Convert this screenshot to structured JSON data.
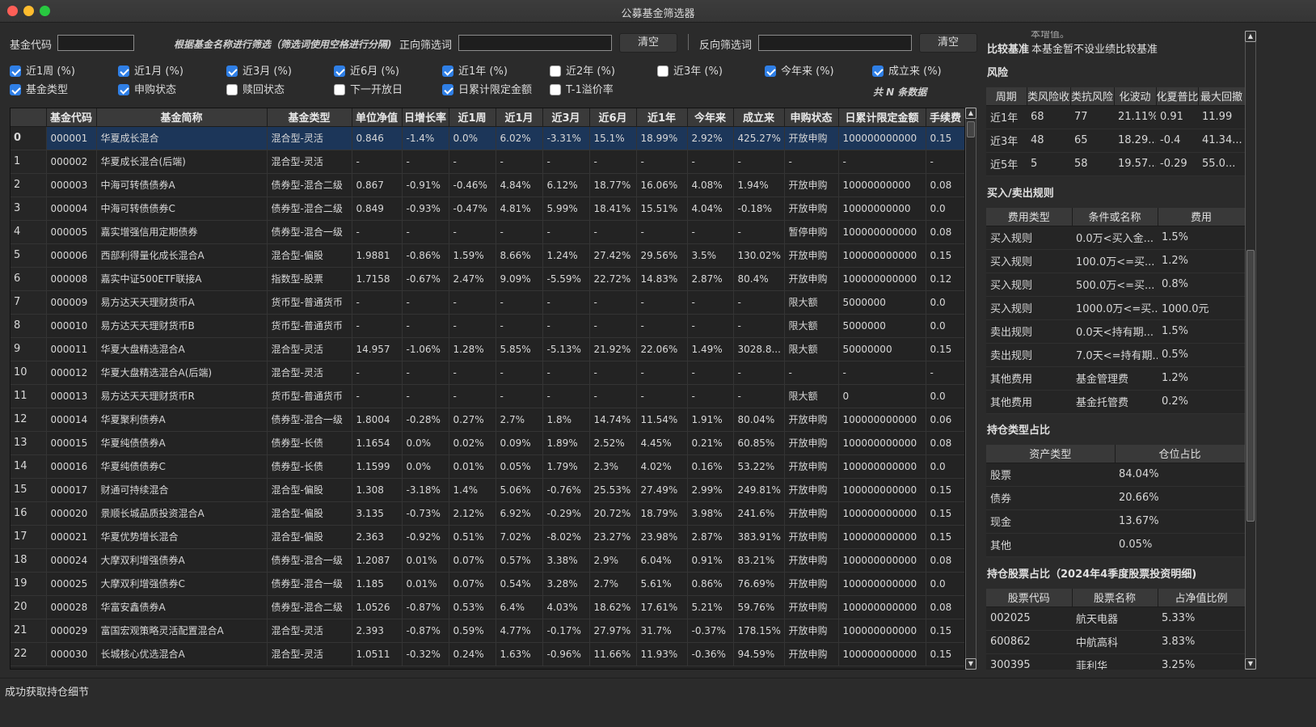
{
  "window": {
    "title": "公募基金筛选器"
  },
  "filter": {
    "code_label": "基金代码",
    "hint": "根据基金名称进行筛选（筛选词使用空格进行分隔)",
    "pos_label": "正向筛选词",
    "neg_label": "反向筛选词",
    "clear1": "清空",
    "clear2": "清空"
  },
  "checks": [
    {
      "label": "近1周 (%)",
      "checked": true
    },
    {
      "label": "近1月 (%)",
      "checked": true
    },
    {
      "label": "近3月 (%)",
      "checked": true
    },
    {
      "label": "近6月 (%)",
      "checked": true
    },
    {
      "label": "近1年 (%)",
      "checked": true
    },
    {
      "label": "近2年 (%)",
      "checked": false
    },
    {
      "label": "近3年 (%)",
      "checked": false
    },
    {
      "label": "今年来 (%)",
      "checked": true
    },
    {
      "label": "成立来 (%)",
      "checked": true
    },
    {
      "label": "基金类型",
      "checked": true
    },
    {
      "label": "申购状态",
      "checked": true
    },
    {
      "label": "赎回状态",
      "checked": false
    },
    {
      "label": "下一开放日",
      "checked": false
    },
    {
      "label": "日累计限定金额",
      "checked": true
    },
    {
      "label": "T-1溢价率",
      "checked": false
    }
  ],
  "count_text": "共 N 条数据",
  "table": {
    "headers": [
      "基金代码",
      "基金简称",
      "基金类型",
      "单位净值",
      "日增长率",
      "近1周",
      "近1月",
      "近3月",
      "近6月",
      "近1年",
      "今年来",
      "成立来",
      "申购状态",
      "日累计限定金额",
      "手续费"
    ],
    "rows": [
      [
        "0",
        "000001",
        "华夏成长混合",
        "混合型-灵活",
        "0.846",
        "-1.4%",
        "0.0%",
        "6.02%",
        "-3.31%",
        "15.1%",
        "18.99%",
        "2.92%",
        "425.27%",
        "开放申购",
        "100000000000",
        "0.15"
      ],
      [
        "1",
        "000002",
        "华夏成长混合(后端)",
        "混合型-灵活",
        "-",
        "-",
        "-",
        "-",
        "-",
        "-",
        "-",
        "-",
        "-",
        "-",
        "-",
        "-"
      ],
      [
        "2",
        "000003",
        "中海可转债债券A",
        "债券型-混合二级",
        "0.867",
        "-0.91%",
        "-0.46%",
        "4.84%",
        "6.12%",
        "18.77%",
        "16.06%",
        "4.08%",
        "1.94%",
        "开放申购",
        "10000000000",
        "0.08"
      ],
      [
        "3",
        "000004",
        "中海可转债债券C",
        "债券型-混合二级",
        "0.849",
        "-0.93%",
        "-0.47%",
        "4.81%",
        "5.99%",
        "18.41%",
        "15.51%",
        "4.04%",
        "-0.18%",
        "开放申购",
        "10000000000",
        "0.0"
      ],
      [
        "4",
        "000005",
        "嘉实增强信用定期债券",
        "债券型-混合一级",
        "-",
        "-",
        "-",
        "-",
        "-",
        "-",
        "-",
        "-",
        "-",
        "暂停申购",
        "100000000000",
        "0.08"
      ],
      [
        "5",
        "000006",
        "西部利得量化成长混合A",
        "混合型-偏股",
        "1.9881",
        "-0.86%",
        "1.59%",
        "8.66%",
        "1.24%",
        "27.42%",
        "29.56%",
        "3.5%",
        "130.02%",
        "开放申购",
        "100000000000",
        "0.15"
      ],
      [
        "6",
        "000008",
        "嘉实中证500ETF联接A",
        "指数型-股票",
        "1.7158",
        "-0.67%",
        "2.47%",
        "9.09%",
        "-5.59%",
        "22.72%",
        "14.83%",
        "2.87%",
        "80.4%",
        "开放申购",
        "100000000000",
        "0.12"
      ],
      [
        "7",
        "000009",
        "易方达天天理财货币A",
        "货币型-普通货币",
        "-",
        "-",
        "-",
        "-",
        "-",
        "-",
        "-",
        "-",
        "-",
        "限大额",
        "5000000",
        "0.0"
      ],
      [
        "8",
        "000010",
        "易方达天天理财货币B",
        "货币型-普通货币",
        "-",
        "-",
        "-",
        "-",
        "-",
        "-",
        "-",
        "-",
        "-",
        "限大额",
        "5000000",
        "0.0"
      ],
      [
        "9",
        "000011",
        "华夏大盘精选混合A",
        "混合型-灵活",
        "14.957",
        "-1.06%",
        "1.28%",
        "5.85%",
        "-5.13%",
        "21.92%",
        "22.06%",
        "1.49%",
        "3028.8...",
        "限大额",
        "50000000",
        "0.15"
      ],
      [
        "10",
        "000012",
        "华夏大盘精选混合A(后端)",
        "混合型-灵活",
        "-",
        "-",
        "-",
        "-",
        "-",
        "-",
        "-",
        "-",
        "-",
        "-",
        "-",
        "-"
      ],
      [
        "11",
        "000013",
        "易方达天天理财货币R",
        "货币型-普通货币",
        "-",
        "-",
        "-",
        "-",
        "-",
        "-",
        "-",
        "-",
        "-",
        "限大额",
        "0",
        "0.0"
      ],
      [
        "12",
        "000014",
        "华夏聚利债券A",
        "债券型-混合一级",
        "1.8004",
        "-0.28%",
        "0.27%",
        "2.7%",
        "1.8%",
        "14.74%",
        "11.54%",
        "1.91%",
        "80.04%",
        "开放申购",
        "100000000000",
        "0.06"
      ],
      [
        "13",
        "000015",
        "华夏纯债债券A",
        "债券型-长债",
        "1.1654",
        "0.0%",
        "0.02%",
        "0.09%",
        "1.89%",
        "2.52%",
        "4.45%",
        "0.21%",
        "60.85%",
        "开放申购",
        "100000000000",
        "0.08"
      ],
      [
        "14",
        "000016",
        "华夏纯债债券C",
        "债券型-长债",
        "1.1599",
        "0.0%",
        "0.01%",
        "0.05%",
        "1.79%",
        "2.3%",
        "4.02%",
        "0.16%",
        "53.22%",
        "开放申购",
        "100000000000",
        "0.0"
      ],
      [
        "15",
        "000017",
        "财通可持续混合",
        "混合型-偏股",
        "1.308",
        "-3.18%",
        "1.4%",
        "5.06%",
        "-0.76%",
        "25.53%",
        "27.49%",
        "2.99%",
        "249.81%",
        "开放申购",
        "100000000000",
        "0.15"
      ],
      [
        "16",
        "000020",
        "景顺长城品质投资混合A",
        "混合型-偏股",
        "3.135",
        "-0.73%",
        "2.12%",
        "6.92%",
        "-0.29%",
        "20.72%",
        "18.79%",
        "3.98%",
        "241.6%",
        "开放申购",
        "100000000000",
        "0.15"
      ],
      [
        "17",
        "000021",
        "华夏优势增长混合",
        "混合型-偏股",
        "2.363",
        "-0.92%",
        "0.51%",
        "7.02%",
        "-8.02%",
        "23.27%",
        "23.98%",
        "2.87%",
        "383.91%",
        "开放申购",
        "100000000000",
        "0.15"
      ],
      [
        "18",
        "000024",
        "大摩双利增强债券A",
        "债券型-混合一级",
        "1.2087",
        "0.01%",
        "0.07%",
        "0.57%",
        "3.38%",
        "2.9%",
        "6.04%",
        "0.91%",
        "83.21%",
        "开放申购",
        "100000000000",
        "0.08"
      ],
      [
        "19",
        "000025",
        "大摩双利增强债券C",
        "债券型-混合一级",
        "1.185",
        "0.01%",
        "0.07%",
        "0.54%",
        "3.28%",
        "2.7%",
        "5.61%",
        "0.86%",
        "76.69%",
        "开放申购",
        "100000000000",
        "0.0"
      ],
      [
        "20",
        "000028",
        "华富安鑫债券A",
        "债券型-混合二级",
        "1.0526",
        "-0.87%",
        "0.53%",
        "6.4%",
        "4.03%",
        "18.62%",
        "17.61%",
        "5.21%",
        "59.76%",
        "开放申购",
        "100000000000",
        "0.08"
      ],
      [
        "21",
        "000029",
        "富国宏观策略灵活配置混合A",
        "混合型-灵活",
        "2.393",
        "-0.87%",
        "0.59%",
        "4.77%",
        "-0.17%",
        "27.97%",
        "31.7%",
        "-0.37%",
        "178.15%",
        "开放申购",
        "100000000000",
        "0.15"
      ],
      [
        "22",
        "000030",
        "长城核心优选混合A",
        "混合型-灵活",
        "1.0511",
        "-0.32%",
        "0.24%",
        "1.63%",
        "-0.96%",
        "11.66%",
        "11.93%",
        "-0.36%",
        "94.59%",
        "开放申购",
        "100000000000",
        "0.15"
      ]
    ]
  },
  "right": {
    "top_partial": "本增值。",
    "benchmark_label": "比较基准",
    "benchmark_value": "本基金暂不设业绩比较基准",
    "risk_title": "风险",
    "risk_headers": [
      "周期",
      "类风险收",
      "类抗风险",
      "化波动",
      "化夏普比",
      "最大回撤"
    ],
    "risk_rows": [
      [
        "近1年",
        "68",
        "77",
        "21.11%",
        "0.91",
        "11.99"
      ],
      [
        "近3年",
        "48",
        "65",
        "18.29...",
        "-0.4",
        "41.34..."
      ],
      [
        "近5年",
        "5",
        "58",
        "19.57...",
        "-0.29",
        "55.0..."
      ]
    ],
    "rules_title": "买入/卖出规则",
    "rules_headers": [
      "费用类型",
      "条件或名称",
      "费用"
    ],
    "rules_rows": [
      [
        "买入规则",
        "0.0万<买入金...",
        "1.5%"
      ],
      [
        "买入规则",
        "100.0万<=买...",
        "1.2%"
      ],
      [
        "买入规则",
        "500.0万<=买...",
        "0.8%"
      ],
      [
        "买入规则",
        "1000.0万<=买...",
        "1000.0元"
      ],
      [
        "卖出规则",
        "0.0天<持有期...",
        "1.5%"
      ],
      [
        "卖出规则",
        "7.0天<=持有期...",
        "0.5%"
      ],
      [
        "其他费用",
        "基金管理费",
        "1.2%"
      ],
      [
        "其他费用",
        "基金托管费",
        "0.2%"
      ]
    ],
    "hold_title": "持仓类型占比",
    "hold_headers": [
      "资产类型",
      "仓位占比"
    ],
    "hold_rows": [
      [
        "股票",
        "84.04%"
      ],
      [
        "债券",
        "20.66%"
      ],
      [
        "现金",
        "13.67%"
      ],
      [
        "其他",
        "0.05%"
      ]
    ],
    "stock_title": "持仓股票占比（2024年4季度股票投资明细)",
    "stock_headers": [
      "股票代码",
      "股票名称",
      "占净值比例"
    ],
    "stock_rows": [
      [
        "002025",
        "航天电器",
        "5.33%"
      ],
      [
        "600862",
        "中航高科",
        "3.83%"
      ],
      [
        "300395",
        "菲利华",
        "3.25%"
      ]
    ]
  },
  "status_text": "成功获取持仓细节",
  "colors": {
    "up": "#f04646",
    "down": "#3fc45a",
    "limit": "#ece43a",
    "selected_row": "#1c3659",
    "checkbox": "#2f7fe6"
  }
}
